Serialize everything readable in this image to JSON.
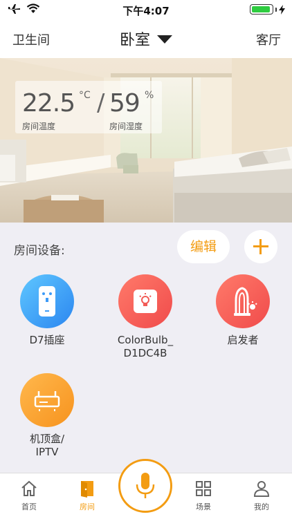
{
  "status_bar": {
    "time": "下午4:07"
  },
  "nav": {
    "left": "卫生间",
    "title": "卧室",
    "right": "客厅"
  },
  "climate": {
    "temperature": "22.5",
    "temp_unit": "°C",
    "temp_label": "房间温度",
    "separator": "/",
    "humidity": "59",
    "hum_unit": "%",
    "hum_label": "房间湿度"
  },
  "devices_section": {
    "title": "房间设备:",
    "edit_label": "编辑"
  },
  "devices": [
    {
      "name": "D7插座",
      "icon": "socket-icon",
      "color": "#3d9bf7"
    },
    {
      "name": "ColorBulb_\nD1DC4B",
      "icon": "bulb-icon",
      "color": "#f25b56"
    },
    {
      "name": "启发者",
      "icon": "inspirer-lamp-icon",
      "color": "#f25b56"
    },
    {
      "name": "机顶盒/\nIPTV",
      "icon": "router-icon",
      "color": "#f79a2c"
    }
  ],
  "tabs": [
    {
      "label": "首页",
      "icon": "home-icon",
      "active": false
    },
    {
      "label": "房间",
      "icon": "door-icon",
      "active": true
    },
    {
      "label": "场景",
      "icon": "grid-icon",
      "active": false
    },
    {
      "label": "我的",
      "icon": "user-icon",
      "active": false
    }
  ],
  "accent_color": "#f39c12"
}
